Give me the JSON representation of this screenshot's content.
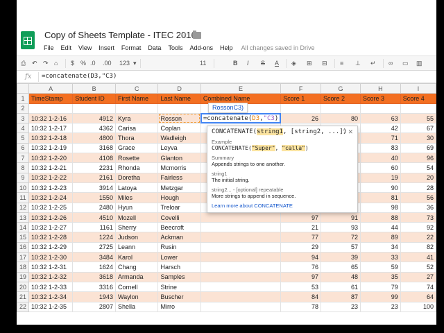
{
  "header": {
    "title": "Copy of Sheets Template - ITEC 2016",
    "menu": [
      "File",
      "Edit",
      "View",
      "Insert",
      "Format",
      "Data",
      "Tools",
      "Add-ons",
      "Help"
    ],
    "save_status": "All changes saved in Drive"
  },
  "toolbar": {
    "percent": "%",
    "decimal_less": ".0",
    "decimal_more": ".00",
    "number_format": "123",
    "font_size": "11",
    "bold": "B",
    "italic": "I",
    "strike": "S",
    "text_color": "A"
  },
  "formula_bar": {
    "fx": "fx",
    "formula": "=concatenate(D3,\"C3)"
  },
  "columns": [
    "A",
    "B",
    "C",
    "D",
    "E",
    "F",
    "G",
    "H",
    "I"
  ],
  "header_row": [
    "TimeStamp",
    "Student ID",
    "First Name",
    "Last Name",
    "Combined Name",
    "Score 1",
    "Score 2",
    "Score 3",
    "Score 4"
  ],
  "rows": [
    {
      "n": "3",
      "cells": [
        "10:32 1-2-16",
        "4912",
        "Kyra",
        "Rosson",
        "",
        "26",
        "80",
        "63",
        "55"
      ]
    },
    {
      "n": "4",
      "cells": [
        "10:32 1-2-17",
        "4362",
        "Carisa",
        "Coplan",
        "",
        "",
        "",
        "42",
        "67"
      ]
    },
    {
      "n": "5",
      "cells": [
        "10:32 1-2-18",
        "4800",
        "Thora",
        "Wadleigh",
        "",
        "",
        "",
        "71",
        "30"
      ]
    },
    {
      "n": "6",
      "cells": [
        "10:32 1-2-19",
        "3168",
        "Grace",
        "Leyva",
        "",
        "",
        "",
        "83",
        "69"
      ]
    },
    {
      "n": "7",
      "cells": [
        "10:32 1-2-20",
        "4108",
        "Rosette",
        "Glanton",
        "",
        "",
        "",
        "40",
        "96"
      ]
    },
    {
      "n": "8",
      "cells": [
        "10:32 1-2-21",
        "2231",
        "Rhonda",
        "Mcmorris",
        "",
        "",
        "",
        "60",
        "54"
      ]
    },
    {
      "n": "9",
      "cells": [
        "10:32 1-2-22",
        "2161",
        "Doretha",
        "Fairless",
        "",
        "",
        "",
        "19",
        "20"
      ]
    },
    {
      "n": "10",
      "cells": [
        "10:32 1-2-23",
        "3914",
        "Latoya",
        "Metzgar",
        "",
        "",
        "",
        "90",
        "28"
      ]
    },
    {
      "n": "11",
      "cells": [
        "10:32 1-2-24",
        "1550",
        "Miles",
        "Hough",
        "",
        "",
        "",
        "81",
        "56"
      ]
    },
    {
      "n": "12",
      "cells": [
        "10:32 1-2-25",
        "2480",
        "Hyun",
        "Treloar",
        "",
        "",
        "",
        "98",
        "36"
      ]
    },
    {
      "n": "13",
      "cells": [
        "10:32 1-2-26",
        "4510",
        "Mozell",
        "Covelli",
        "",
        "97",
        "91",
        "88",
        "73"
      ]
    },
    {
      "n": "14",
      "cells": [
        "10:32 1-2-27",
        "1161",
        "Sherry",
        "Beecroft",
        "",
        "21",
        "93",
        "44",
        "92"
      ]
    },
    {
      "n": "15",
      "cells": [
        "10:32 1-2-28",
        "1224",
        "Judson",
        "Ackman",
        "",
        "77",
        "72",
        "89",
        "22"
      ]
    },
    {
      "n": "16",
      "cells": [
        "10:32 1-2-29",
        "2725",
        "Leann",
        "Rusin",
        "",
        "29",
        "57",
        "34",
        "82"
      ]
    },
    {
      "n": "17",
      "cells": [
        "10:32 1-2-30",
        "3484",
        "Karol",
        "Lower",
        "",
        "94",
        "39",
        "33",
        "41"
      ]
    },
    {
      "n": "18",
      "cells": [
        "10:32 1-2-31",
        "1624",
        "Chang",
        "Harsch",
        "",
        "76",
        "65",
        "59",
        "52"
      ]
    },
    {
      "n": "19",
      "cells": [
        "10:32 1-2-32",
        "3618",
        "Armanda",
        "Samples",
        "",
        "97",
        "48",
        "35",
        "27"
      ]
    },
    {
      "n": "20",
      "cells": [
        "10:32 1-2-33",
        "3316",
        "Cornell",
        "Strine",
        "",
        "53",
        "61",
        "79",
        "74"
      ]
    },
    {
      "n": "21",
      "cells": [
        "10:32 1-2-34",
        "1943",
        "Waylon",
        "Buscher",
        "",
        "84",
        "87",
        "99",
        "64"
      ]
    },
    {
      "n": "22",
      "cells": [
        "10:32 1-2-35",
        "2807",
        "Shella",
        "Mirro",
        "",
        "78",
        "23",
        "23",
        "100"
      ]
    }
  ],
  "editing_cell": {
    "prefix": "=concatenate(",
    "ref1": "D3",
    "comma": ",",
    "ref2": "\"C3",
    "suffix": ")"
  },
  "preview": "RossonC3)",
  "help": {
    "sig_fn": "CONCATENATE(",
    "sig_arg1": "string1",
    "sig_rest": ", [string2, ...])",
    "example_title": "Example",
    "example_fn": "CONCATENATE(",
    "example_a": "\"Super\"",
    "example_sep": ", ",
    "example_b": "\"calla\"",
    "example_end": ")",
    "summary_title": "Summary",
    "summary": "Appends strings to one another.",
    "arg1_title": "string1",
    "arg1_desc": "The initial string.",
    "arg2_title": "string2... - [optional] repeatable",
    "arg2_desc": "More strings to append in sequence.",
    "learn_more": "Learn more about CONCATENATE"
  }
}
